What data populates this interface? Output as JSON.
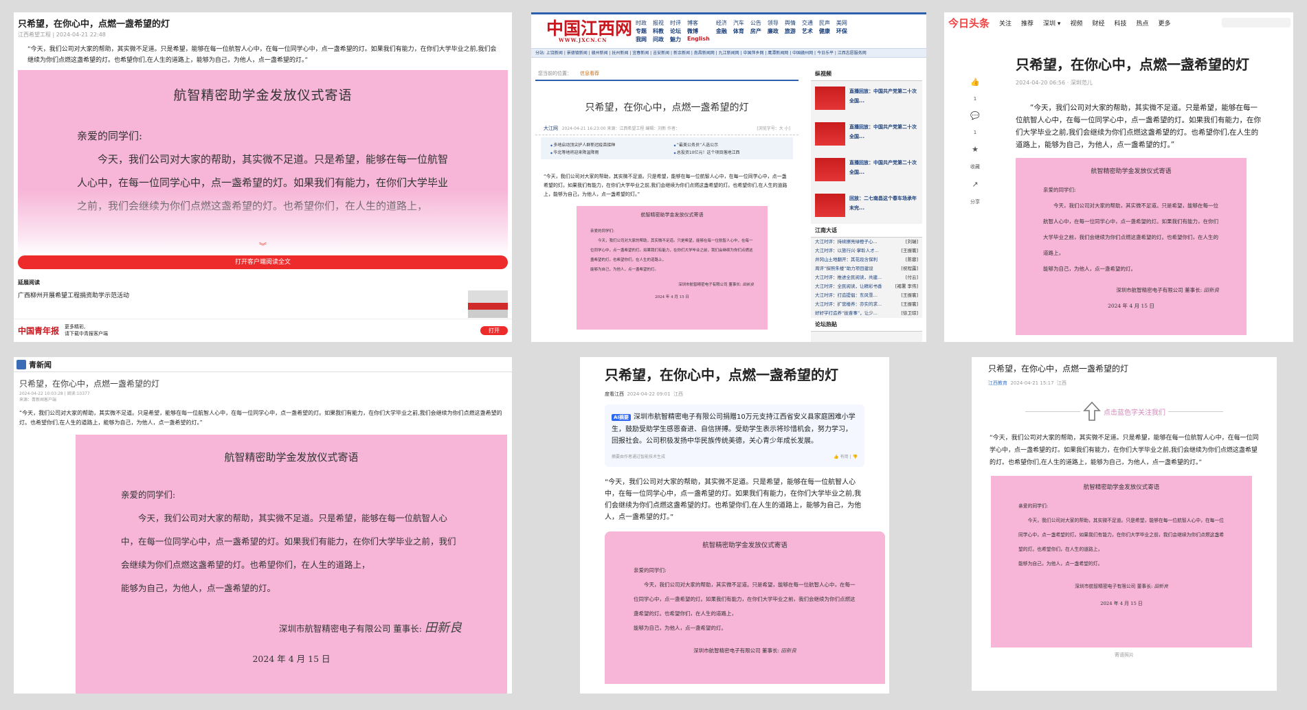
{
  "letter": {
    "title": "航智精密助学金发放仪式寄语",
    "salutation": "亲爱的同学们:",
    "para1": "今天，我们公司对大家的帮助，其实微不足道。只是希望，能够在每一位航智人心中，在每一位同学心中，点一盏希望的灯。如果我们有能力，在你们大学毕业之前，我们会继续为你们点燃这盏希望的灯。也希望你们，在人生的道路上，",
    "para2": "能够为自己，为他人，点一盏希望的灯。",
    "company": "深圳市航智精密电子有限公司 董事长:",
    "signature": "田新良",
    "date": "2024 年 4 月 15 日"
  },
  "article_title": "只希望，在你心中，点燃一盏希望的灯",
  "intro_quote": "“今天，我们公司对大家的帮助，其实微不足道。只是希望，能够在每一位航智人心中，在每一位同学心中，点一盏希望的灯。如果我们有能力，在你们大学毕业之前,我们会继续为你们点燃这盏希望的灯。也希望你们,在人生的道路上，能够为自己，为他人，点一盏希望的灯。”",
  "p1": {
    "meta": "江西希望工程 | 2024-04-21 22:48",
    "open_app": "打开客户端阅读全文",
    "extended": "延展阅读",
    "related": "广西柳州开展希望工程捐资助学示范活动",
    "logo": "中国青年报",
    "promo1": "更多精彩,",
    "promo2": "请下载中青报客户端",
    "open": "打开"
  },
  "p2": {
    "logo": "中国江西网",
    "logo_url": "WWW.JXCN.CN",
    "nav": [
      "时政",
      "报视",
      "时评",
      "博客",
      "经济",
      "汽车",
      "公告",
      "领导",
      "舆情",
      "交通",
      "民声",
      "美网",
      "专题",
      "科教",
      "论坛",
      "微博",
      "金融",
      "体育",
      "房产",
      "廉政",
      "旅游",
      "艺术",
      "健康",
      "环保"
    ],
    "nav_extra": [
      "我网",
      "问政",
      "魅力",
      "English"
    ],
    "subnav": "分站: 上饶新闻 | 景德镇新闻 | 赣州新闻 | 抚州新闻 | 宜春新闻 | 吉安新闻 | 新余新闻 | 南昌新闻网 | 九江新闻网 | 中国萍乡网 | 鹰潭新闻网 | 中国赣州网 | 今日乐平 | 江西志愿服务网",
    "crumb_label": "您当前的位置：",
    "crumb": "信息看荐",
    "source_site": "大江网",
    "meta": "2024-04-21 16:23:00  来源：江西希望工程  编辑：刘新  作者：",
    "fontsize": "[浏览字号：大  小]",
    "links": [
      "多地启动顶尖护人群新冠疫苗接种",
      "“最美公务员”人选公示",
      "华北等地将迎来降温降雨",
      "总投资10亿元！这个项目落地江西"
    ],
    "side_video": "纵视频",
    "videos": [
      "直播回放：中国共产党第二十次全国...",
      "直播回放：中国共产党第二十次全国...",
      "直播回放：中国共产党第二十次全国...",
      "回放：二七南昌这个春车场承年末完..."
    ],
    "side_talk": "江南大话",
    "talks": [
      [
        "大江时评：持续擦亮绿橙子心...",
        "[刘瑞]"
      ],
      [
        "大江时评：以旅行兴·掌聆人才...",
        "[王振寰]"
      ],
      [
        "井冈山土地翻开：其花段含保利",
        "[陈蓉]"
      ],
      [
        "周评“探照朱楼”助力项目建设",
        "[祝程露]"
      ],
      [
        "大江时评：推进全民阅读，共建...",
        "[付云]"
      ],
      [
        "大江时评：全民阅读，让精彩书香",
        "[褚署 李伟]"
      ],
      [
        "大江时评：打造提倡：东风雪…",
        "[王振寰]"
      ],
      [
        "大江时评：扩营楼养：亦实的求...",
        "[王振寰]"
      ],
      [
        "好好学打造养“拢奋事”，让少...",
        "[徐卫琼]"
      ]
    ],
    "side_forum": "论坛热贴"
  },
  "p3": {
    "logo": "今日头条",
    "nav": [
      "关注",
      "推荐",
      "深圳 ▾",
      "视频",
      "财经",
      "科技",
      "热点",
      "更多"
    ],
    "meta": "2024-04-20 06:56 · 深圳范儿",
    "actions": [
      [
        "👍",
        "1"
      ],
      [
        "💬",
        "1"
      ],
      [
        "★",
        "收藏"
      ],
      [
        "↗",
        "分享"
      ]
    ]
  },
  "p4": {
    "site": "青新闻",
    "meta1": "2024-04-22 10:03:28 | 阅读:10377",
    "meta2": "来源：青新闻客户端"
  },
  "p5": {
    "source": "度看江西",
    "date": "2024-04-22 09:01",
    "region": "江西",
    "ai_tag": "AI摘要",
    "ai_summary": "深圳市航智精密电子有限公司捐赠10万元支持江西省安义县家庭困难小学生，鼓励受助学生感恩奋进、自信拼搏。受助学生表示将珍惜机会，努力学习，回报社会。公司积极发扬中华民族传统美德，关心青少年成长发展。",
    "ai_foot": "摘要由作者通过智能技术生成",
    "useful": "有用"
  },
  "p6": {
    "source": "江西教育",
    "date": "2024-04-21 15:17",
    "region": "江西",
    "follow": "点击蓝色字关注我们",
    "caption": "寄语照片"
  }
}
